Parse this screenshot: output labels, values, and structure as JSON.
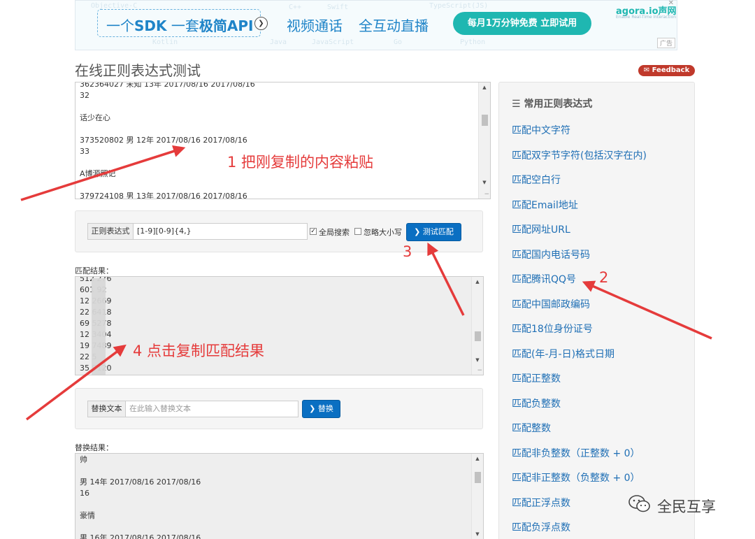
{
  "banner": {
    "sdk_prefix": "一个",
    "sdk_bold": "SDK",
    "api_prefix": "一套",
    "api_bold": "极简API",
    "video": "视频通话",
    "live": "全互动直播",
    "cta": "每月1万分钟免费  立即试用",
    "brand": "agora.io声网",
    "brand_sub": "Enable Real-Time Interaction",
    "ad_tag": "广告",
    "ghost": [
      "Objective-C",
      "C++",
      "Swift",
      "TypeScript(JS)",
      "Kotlin",
      "Java",
      "JavaScript",
      "Go",
      "Python"
    ]
  },
  "page": {
    "title": "在线正则表达式测试",
    "feedback": "Feedback"
  },
  "input_text": {
    "lines": [
      "362364027  未知  13年 2017/08/16  2017/08/16",
      "32",
      "",
      "话少在心",
      "",
      "373520802  男  12年 2017/08/16  2017/08/16",
      "33",
      "",
      "A博源照记",
      "",
      "379724108  男  13年 2017/08/16  2017/08/16"
    ]
  },
  "regex_form": {
    "label": "正则表达式",
    "value": "[1-9][0-9]{4,}",
    "global_label": "全局搜索",
    "global_checked": true,
    "ignorecase_label": "忽略大小写",
    "ignorecase_checked": false,
    "test_button": "测试匹配"
  },
  "match": {
    "label": "匹配结果：",
    "lines": [
      "512    276",
      "601    92",
      "12    2669",
      "22    6418",
      "69    5278",
      "12    3404",
      "19    7489",
      "22    5",
      "35    9120"
    ]
  },
  "replace_form": {
    "label": "替换文本",
    "placeholder": "在此输入替换文本",
    "button": "替换"
  },
  "replace_result": {
    "label": "替换结果：",
    "lines": [
      "帅",
      "",
      "  男  14年 2017/08/16  2017/08/16",
      "16",
      "",
      "豪情",
      "",
      "  男  16年 2017/08/16  2017/08/16"
    ]
  },
  "sidebar": {
    "title": "常用正则表达式",
    "items": [
      "匹配中文字符",
      "匹配双字节字符(包括汉字在内)",
      "匹配空白行",
      "匹配Email地址",
      "匹配网址URL",
      "匹配国内电话号码",
      "匹配腾讯QQ号",
      "匹配中国邮政编码",
      "匹配18位身份证号",
      "匹配(年-月-日)格式日期",
      "匹配正整数",
      "匹配负整数",
      "匹配整数",
      "匹配非负整数（正整数 + 0）",
      "匹配非正整数（负整数 + 0）",
      "匹配正浮点数",
      "匹配负浮点数"
    ]
  },
  "annotations": {
    "step1": "1 把刚复制的内容粘贴",
    "step2": "2",
    "step3": "3",
    "step4": "4 点击复制匹配结果",
    "color": "#e53b3b"
  },
  "watermark": {
    "text": "全民互享"
  }
}
